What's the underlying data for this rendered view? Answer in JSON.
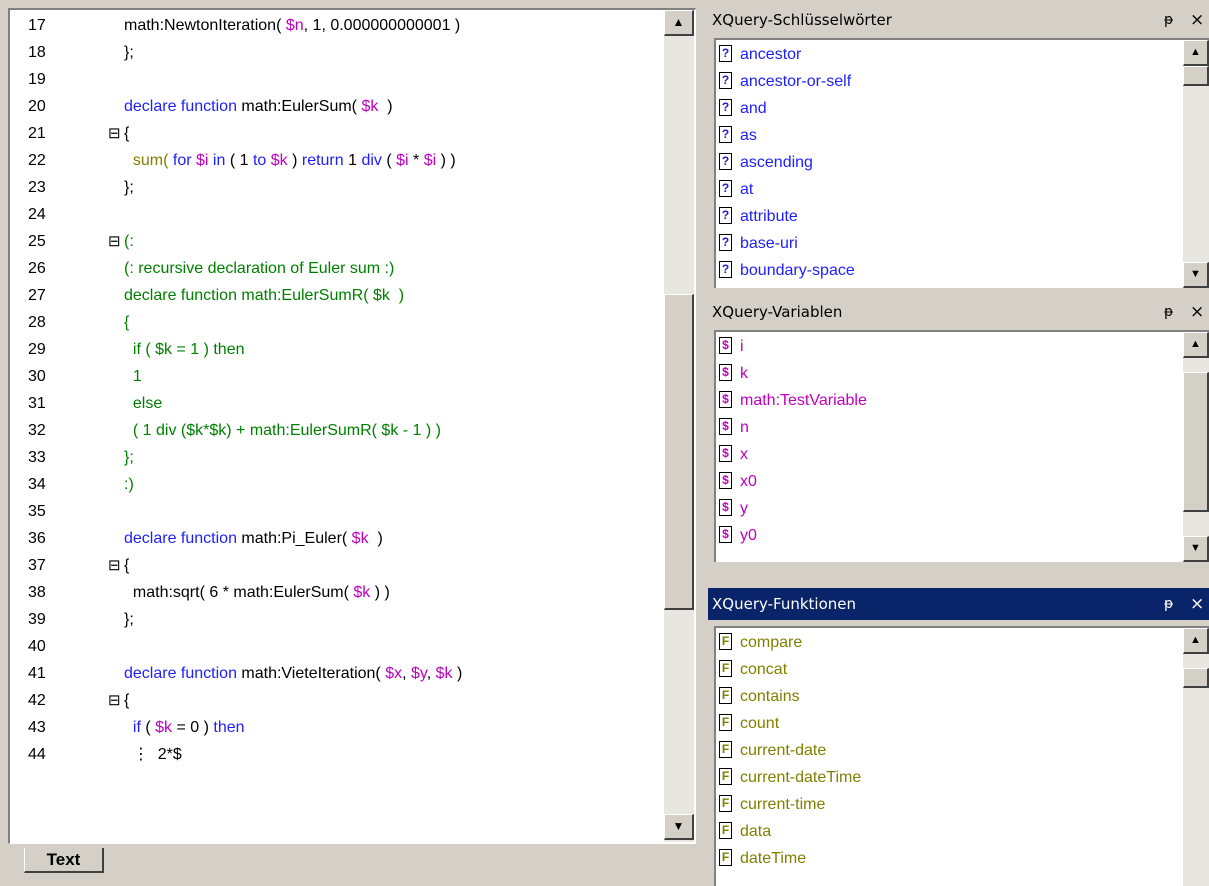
{
  "editor": {
    "lines": [
      {
        "n": "17",
        "fold": "",
        "parts": [
          [
            "fn",
            "math:NewtonIteration( "
          ],
          [
            "var",
            "$n"
          ],
          [
            "fn",
            ", 1, 0.000000000001 )"
          ]
        ]
      },
      {
        "n": "18",
        "fold": "",
        "parts": [
          [
            "fn",
            "};"
          ]
        ]
      },
      {
        "n": "19",
        "fold": "",
        "parts": []
      },
      {
        "n": "20",
        "fold": "",
        "parts": [
          [
            "kw",
            "declare function "
          ],
          [
            "fn",
            "math:EulerSum( "
          ],
          [
            "var",
            "$k"
          ],
          [
            "fn",
            "  )"
          ]
        ]
      },
      {
        "n": "21",
        "fold": "⊟",
        "parts": [
          [
            "fn",
            "{"
          ]
        ]
      },
      {
        "n": "22",
        "fold": "",
        "parts": [
          [
            "ol",
            "  sum( "
          ],
          [
            "kw",
            "for "
          ],
          [
            "var",
            "$i"
          ],
          [
            "kw",
            " in "
          ],
          [
            "fn",
            "( 1 "
          ],
          [
            "kw",
            "to "
          ],
          [
            "var",
            "$k"
          ],
          [
            "fn",
            " ) "
          ],
          [
            "kw",
            "return "
          ],
          [
            "fn",
            "1 "
          ],
          [
            "kw",
            "div "
          ],
          [
            "fn",
            "( "
          ],
          [
            "var",
            "$i"
          ],
          [
            "fn",
            " * "
          ],
          [
            "var",
            "$i"
          ],
          [
            "fn",
            " ) )"
          ]
        ]
      },
      {
        "n": "23",
        "fold": "",
        "parts": [
          [
            "fn",
            "};"
          ]
        ]
      },
      {
        "n": "24",
        "fold": "",
        "parts": []
      },
      {
        "n": "25",
        "fold": "⊟",
        "parts": [
          [
            "cm",
            "(:"
          ]
        ]
      },
      {
        "n": "26",
        "fold": "",
        "parts": [
          [
            "cm",
            "(: recursive declaration of Euler sum :)"
          ]
        ]
      },
      {
        "n": "27",
        "fold": "",
        "parts": [
          [
            "cm",
            "declare function math:EulerSumR( $k  )"
          ]
        ]
      },
      {
        "n": "28",
        "fold": "",
        "parts": [
          [
            "cm",
            "{"
          ]
        ]
      },
      {
        "n": "29",
        "fold": "",
        "parts": [
          [
            "cm",
            "  if ( $k = 1 ) then"
          ]
        ]
      },
      {
        "n": "30",
        "fold": "",
        "parts": [
          [
            "cm",
            "  1"
          ]
        ]
      },
      {
        "n": "31",
        "fold": "",
        "parts": [
          [
            "cm",
            "  else"
          ]
        ]
      },
      {
        "n": "32",
        "fold": "",
        "parts": [
          [
            "cm",
            "  ( 1 div ($k*$k) + math:EulerSumR( $k - 1 ) )"
          ]
        ]
      },
      {
        "n": "33",
        "fold": "",
        "parts": [
          [
            "cm",
            "};"
          ]
        ]
      },
      {
        "n": "34",
        "fold": "",
        "parts": [
          [
            "cm",
            ":)"
          ]
        ]
      },
      {
        "n": "35",
        "fold": "",
        "parts": []
      },
      {
        "n": "36",
        "fold": "",
        "parts": [
          [
            "kw",
            "declare function "
          ],
          [
            "fn",
            "math:Pi_Euler( "
          ],
          [
            "var",
            "$k"
          ],
          [
            "fn",
            "  )"
          ]
        ]
      },
      {
        "n": "37",
        "fold": "⊟",
        "parts": [
          [
            "fn",
            "{"
          ]
        ]
      },
      {
        "n": "38",
        "fold": "",
        "parts": [
          [
            "fn",
            "  math:sqrt( 6 * math:EulerSum( "
          ],
          [
            "var",
            "$k"
          ],
          [
            "fn",
            " ) )"
          ]
        ]
      },
      {
        "n": "39",
        "fold": "",
        "parts": [
          [
            "fn",
            "};"
          ]
        ]
      },
      {
        "n": "40",
        "fold": "",
        "parts": []
      },
      {
        "n": "41",
        "fold": "",
        "parts": [
          [
            "kw",
            "declare function "
          ],
          [
            "fn",
            "math:VieteIteration( "
          ],
          [
            "var",
            "$x"
          ],
          [
            "fn",
            ", "
          ],
          [
            "var",
            "$y"
          ],
          [
            "fn",
            ", "
          ],
          [
            "var",
            "$k"
          ],
          [
            "fn",
            " )"
          ]
        ]
      },
      {
        "n": "42",
        "fold": "⊟",
        "parts": [
          [
            "fn",
            "{"
          ]
        ]
      },
      {
        "n": "43",
        "fold": "",
        "parts": [
          [
            "kw",
            "  if "
          ],
          [
            "fn",
            "( "
          ],
          [
            "var",
            "$k"
          ],
          [
            "fn",
            " = 0 ) "
          ],
          [
            "kw",
            "then"
          ]
        ]
      },
      {
        "n": "44",
        "fold": "",
        "parts": [
          [
            "fn",
            "  ⋮  2*$"
          ]
        ]
      }
    ],
    "tab_label": "Text"
  },
  "panels": {
    "keywords": {
      "title": "XQuery-Schlüsselwörter",
      "items": [
        "ancestor",
        "ancestor-or-self",
        "and",
        "as",
        "ascending",
        "at",
        "attribute",
        "base-uri",
        "boundary-space"
      ]
    },
    "variables": {
      "title": "XQuery-Variablen",
      "items": [
        "i",
        "k",
        "math:TestVariable",
        "n",
        "x",
        "x0",
        "y",
        "y0"
      ]
    },
    "functions": {
      "title": "XQuery-Funktionen",
      "items": [
        "compare",
        "concat",
        "contains",
        "count",
        "current-date",
        "current-dateTime",
        "current-time",
        "data",
        "dateTime"
      ]
    },
    "pin_glyph": "ᵽ",
    "close_glyph": "×",
    "icons": {
      "keyword": "?",
      "variable": "$",
      "function": "F"
    }
  }
}
